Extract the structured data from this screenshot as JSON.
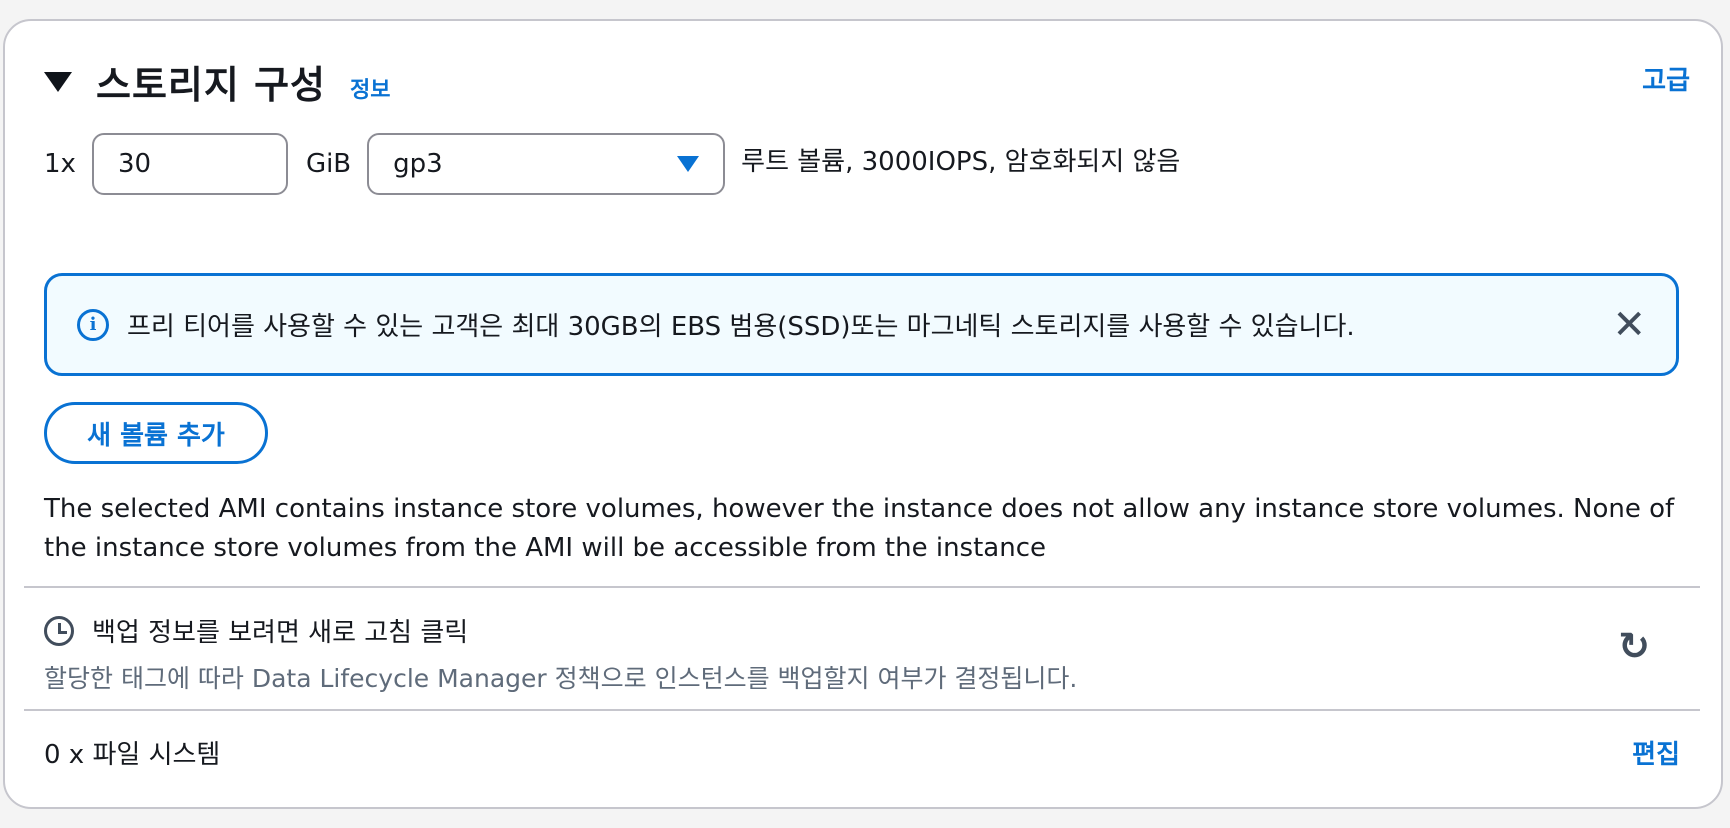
{
  "storage": {
    "title": "스토리지 구성",
    "info_link": "정보",
    "advanced_link": "고급"
  },
  "volume": {
    "multiplier": "1x",
    "size_value": "30",
    "unit": "GiB",
    "volume_type": "gp3",
    "description": "루트 볼륨,  3000IOPS,  암호화되지 않음"
  },
  "alert": {
    "icon": "info-icon",
    "text": "프리 티어를 사용할 수 있는 고객은 최대 30GB의 EBS 범용(SSD)또는 마그네틱 스토리지를 사용할 수 있습니다.",
    "close_glyph": "✕"
  },
  "add_volume_label": "새 볼륨 추가",
  "ami_note": "The selected AMI contains instance store volumes, however the instance does not allow any instance store volumes. None of the instance store volumes from the AMI will be accessible from the instance",
  "backup": {
    "title": "백업 정보를 보려면 새로 고침 클릭",
    "subtitle": "할당한 태그에 따라 Data Lifecycle Manager 정책으로 인스턴스를 백업할지 여부가 결정됩니다.",
    "refresh_glyph": "↻"
  },
  "file_systems": {
    "label": "0 x 파일 시스템",
    "edit_link": "편집"
  },
  "colors": {
    "accent": "#0972d3",
    "alert_bg": "#f2fbff",
    "border": "#c6c6cd"
  }
}
